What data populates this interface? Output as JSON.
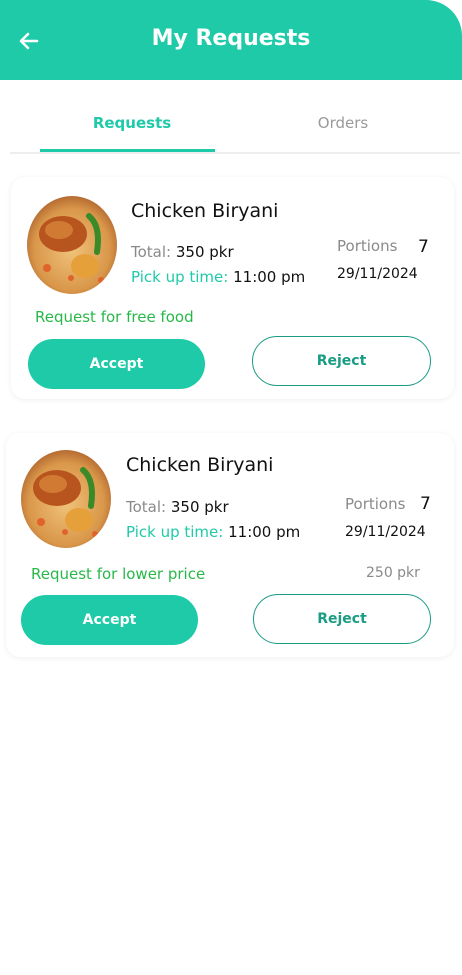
{
  "header": {
    "title": "My Requests",
    "back_icon": "arrow-left-icon"
  },
  "tabs": [
    {
      "label": "Requests",
      "active": true
    },
    {
      "label": "Orders",
      "active": false
    }
  ],
  "colors": {
    "accent": "#1ecaa8",
    "reject_border": "#1a9c84",
    "note_green": "#28b84a"
  },
  "requests": [
    {
      "food_name": "Chicken Biryani",
      "total_label": "Total:",
      "total_value": "350 pkr",
      "pickup_label": "Pick up time:",
      "pickup_value": "11:00 pm",
      "portions_label": "Portions",
      "portions_value": "7",
      "date": "29/11/2024",
      "note": "Request for free food",
      "offer_price": "",
      "accept_label": "Accept",
      "reject_label": "Reject"
    },
    {
      "food_name": "Chicken Biryani",
      "total_label": "Total:",
      "total_value": "350 pkr",
      "pickup_label": "Pick up time:",
      "pickup_value": "11:00 pm",
      "portions_label": "Portions",
      "portions_value": "7",
      "date": "29/11/2024",
      "note": "Request for lower price",
      "offer_price": "250 pkr",
      "accept_label": "Accept",
      "reject_label": "Reject"
    }
  ]
}
